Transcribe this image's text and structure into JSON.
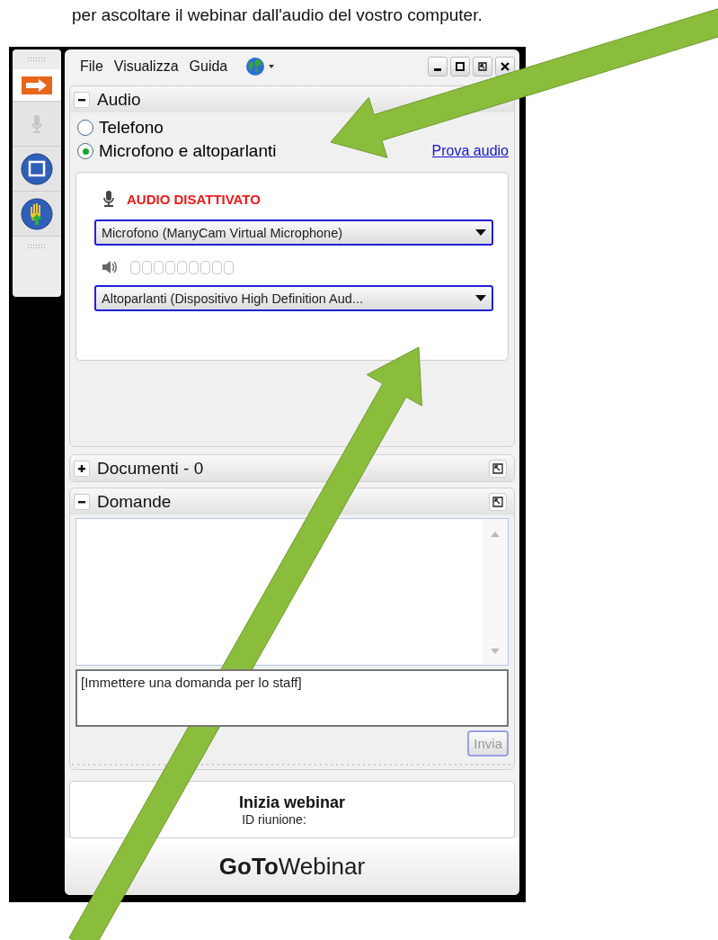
{
  "intro_text": "per ascoltare il webinar dall'audio del vostro computer.",
  "toolbar": [
    {
      "kind": "arrow",
      "disabled": false
    },
    {
      "kind": "mic",
      "disabled": true
    },
    {
      "kind": "screen",
      "disabled": false
    },
    {
      "kind": "hand",
      "disabled": false
    }
  ],
  "menu": [
    "File",
    "Visualizza",
    "Guida"
  ],
  "audio": {
    "title": "Audio",
    "expanded": true,
    "options": [
      {
        "label": "Telefono",
        "selected": false
      },
      {
        "label": "Microfono e altoparlanti",
        "selected": true
      }
    ],
    "test_link": "Prova audio",
    "status": "AUDIO DISATTIVATO",
    "microphone": "Microfono (ManyCam Virtual Microphone)",
    "speaker_level": {
      "level": 0
    },
    "speakers": "Altoparlanti (Dispositivo High Definition Aud..."
  },
  "documents": {
    "title": "Documenti - 0",
    "expanded": false
  },
  "questions": {
    "title": "Domande",
    "expanded": true,
    "placeholder": "[Immettere una domanda per lo staff]",
    "send": "Invia",
    "send_disabled": true
  },
  "webinar": {
    "title": "Inizia webinar",
    "id_label": "ID riunione:"
  },
  "logo": {
    "bold": "GoTo",
    "light": "Webinar"
  }
}
